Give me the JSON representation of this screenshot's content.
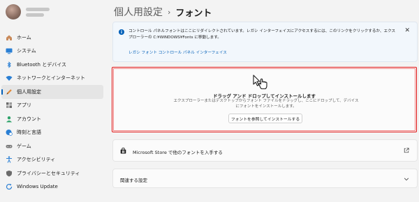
{
  "sidebar": {
    "items": [
      {
        "label": "ホーム",
        "icon": "home-icon",
        "color": "#c98a5b"
      },
      {
        "label": "システム",
        "icon": "monitor-icon",
        "color": "#2a7fd4"
      },
      {
        "label": "Bluetooth とデバイス",
        "icon": "bluetooth-icon",
        "color": "#2a7fd4"
      },
      {
        "label": "ネットワークとインターネット",
        "icon": "wifi-icon",
        "color": "#2a7fd4"
      },
      {
        "label": "個人用設定",
        "icon": "pen-icon",
        "color": "#e08a3a",
        "selected": true
      },
      {
        "label": "アプリ",
        "icon": "apps-icon",
        "color": "#6b6b6b"
      },
      {
        "label": "アカウント",
        "icon": "account-icon",
        "color": "#2ea36a"
      },
      {
        "label": "時刻と言語",
        "icon": "globe-clock-icon",
        "color": "#2a7fd4"
      },
      {
        "label": "ゲーム",
        "icon": "gamepad-icon",
        "color": "#7a7a7a"
      },
      {
        "label": "アクセシビリティ",
        "icon": "accessibility-icon",
        "color": "#2a7fd4"
      },
      {
        "label": "プライバシーとセキュリティ",
        "icon": "shield-icon",
        "color": "#6b6b6b"
      },
      {
        "label": "Windows Update",
        "icon": "update-icon",
        "color": "#2a7fd4"
      }
    ]
  },
  "header": {
    "parent": "個人用設定",
    "separator": "›",
    "current": "フォント"
  },
  "info": {
    "text": "コントロール パネルフォントはここにリダイレクトされています。レガシ インターフェイスにアクセスするには、このリンクをクリックするか、エクスプローラーの C:¥WINDOWS¥Fonts に移動します。",
    "link": "レガシ フォント コントロール パネル インターフェイス",
    "close": "✕"
  },
  "dropzone": {
    "title": "ドラッグ アンド ドロップしてインストールします",
    "desc": "エクスプローラーまたはデスクトップからフォント ファイルをドラッグし、ここにドロップして、デバイスにフォントをインストールします。",
    "button": "フォントを参照してインストールする",
    "border_color": "#e01010"
  },
  "store": {
    "label": "Microsoft Store で他のフォントを入手する"
  },
  "related": {
    "label": "関連する設定"
  }
}
